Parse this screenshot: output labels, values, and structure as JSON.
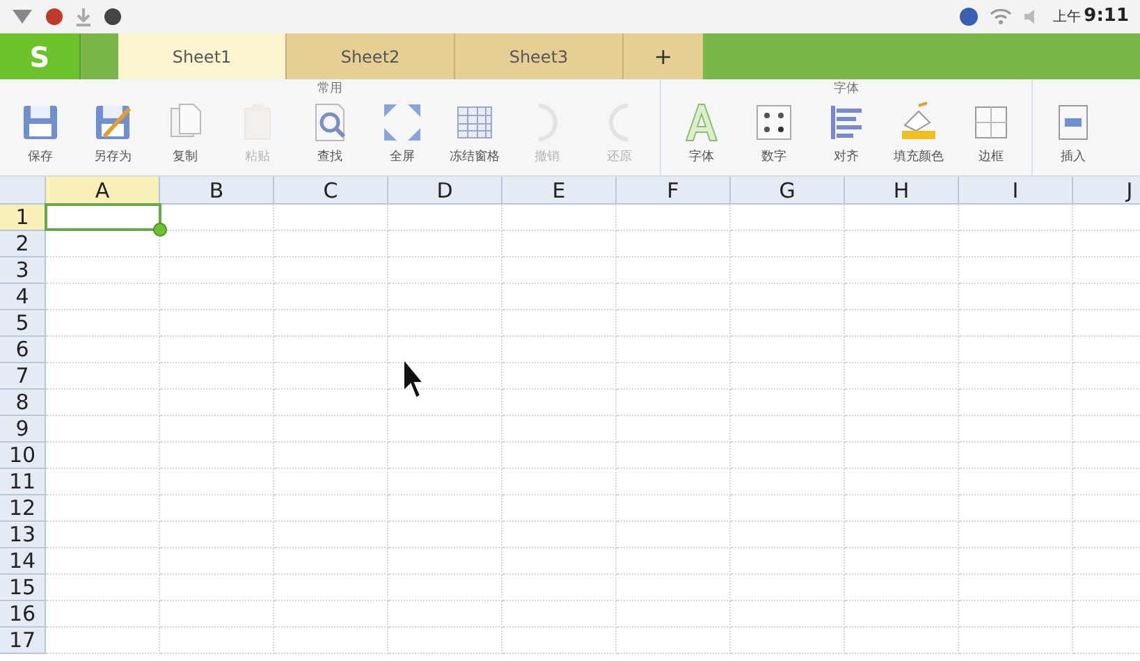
{
  "status_bar": {
    "period": "上午",
    "time": "9:11"
  },
  "app_button": {
    "label": "S"
  },
  "tabs": [
    {
      "label": "Sheet1",
      "selected": true
    },
    {
      "label": "Sheet2",
      "selected": false
    },
    {
      "label": "Sheet3",
      "selected": false
    }
  ],
  "add_tab": {
    "label": "+"
  },
  "ribbon": {
    "groups": [
      {
        "label": "常用",
        "items": [
          {
            "kind": "save",
            "label": "保存",
            "disabled": false
          },
          {
            "kind": "saveas",
            "label": "另存为",
            "disabled": false
          },
          {
            "kind": "copy",
            "label": "复制",
            "disabled": false
          },
          {
            "kind": "paste",
            "label": "粘贴",
            "disabled": true
          },
          {
            "kind": "find",
            "label": "查找",
            "disabled": false
          },
          {
            "kind": "fullscreen",
            "label": "全屏",
            "disabled": false
          },
          {
            "kind": "freeze",
            "label": "冻结窗格",
            "disabled": false
          },
          {
            "kind": "undo",
            "label": "撤销",
            "disabled": true
          },
          {
            "kind": "redo",
            "label": "还原",
            "disabled": true
          }
        ]
      },
      {
        "label": "字体",
        "items": [
          {
            "kind": "font",
            "label": "字体",
            "disabled": false
          },
          {
            "kind": "number",
            "label": "数字",
            "disabled": false
          },
          {
            "kind": "align",
            "label": "对齐",
            "disabled": false
          },
          {
            "kind": "fill",
            "label": "填充颜色",
            "disabled": false
          },
          {
            "kind": "border",
            "label": "边框",
            "disabled": false
          }
        ]
      },
      {
        "items": [
          {
            "kind": "insert",
            "label": "插入",
            "disabled": false
          }
        ]
      }
    ]
  },
  "sheet": {
    "columns": [
      {
        "label": "A",
        "selected": true
      },
      {
        "label": "B",
        "selected": false
      },
      {
        "label": "C",
        "selected": false
      },
      {
        "label": "D",
        "selected": false
      },
      {
        "label": "E",
        "selected": false
      },
      {
        "label": "F",
        "selected": false
      },
      {
        "label": "G",
        "selected": false
      },
      {
        "label": "H",
        "selected": false
      },
      {
        "label": "I",
        "selected": false
      },
      {
        "label": "J",
        "selected": false
      }
    ],
    "rows": [
      {
        "label": "1",
        "selected": true
      },
      {
        "label": "2",
        "selected": false
      },
      {
        "label": "3",
        "selected": false
      },
      {
        "label": "4",
        "selected": false
      },
      {
        "label": "5",
        "selected": false
      },
      {
        "label": "6",
        "selected": false
      },
      {
        "label": "7",
        "selected": false
      },
      {
        "label": "8",
        "selected": false
      },
      {
        "label": "9",
        "selected": false
      },
      {
        "label": "10",
        "selected": false
      },
      {
        "label": "11",
        "selected": false
      },
      {
        "label": "12",
        "selected": false
      },
      {
        "label": "13",
        "selected": false
      },
      {
        "label": "14",
        "selected": false
      },
      {
        "label": "15",
        "selected": false
      },
      {
        "label": "16",
        "selected": false
      },
      {
        "label": "17",
        "selected": false
      }
    ]
  }
}
